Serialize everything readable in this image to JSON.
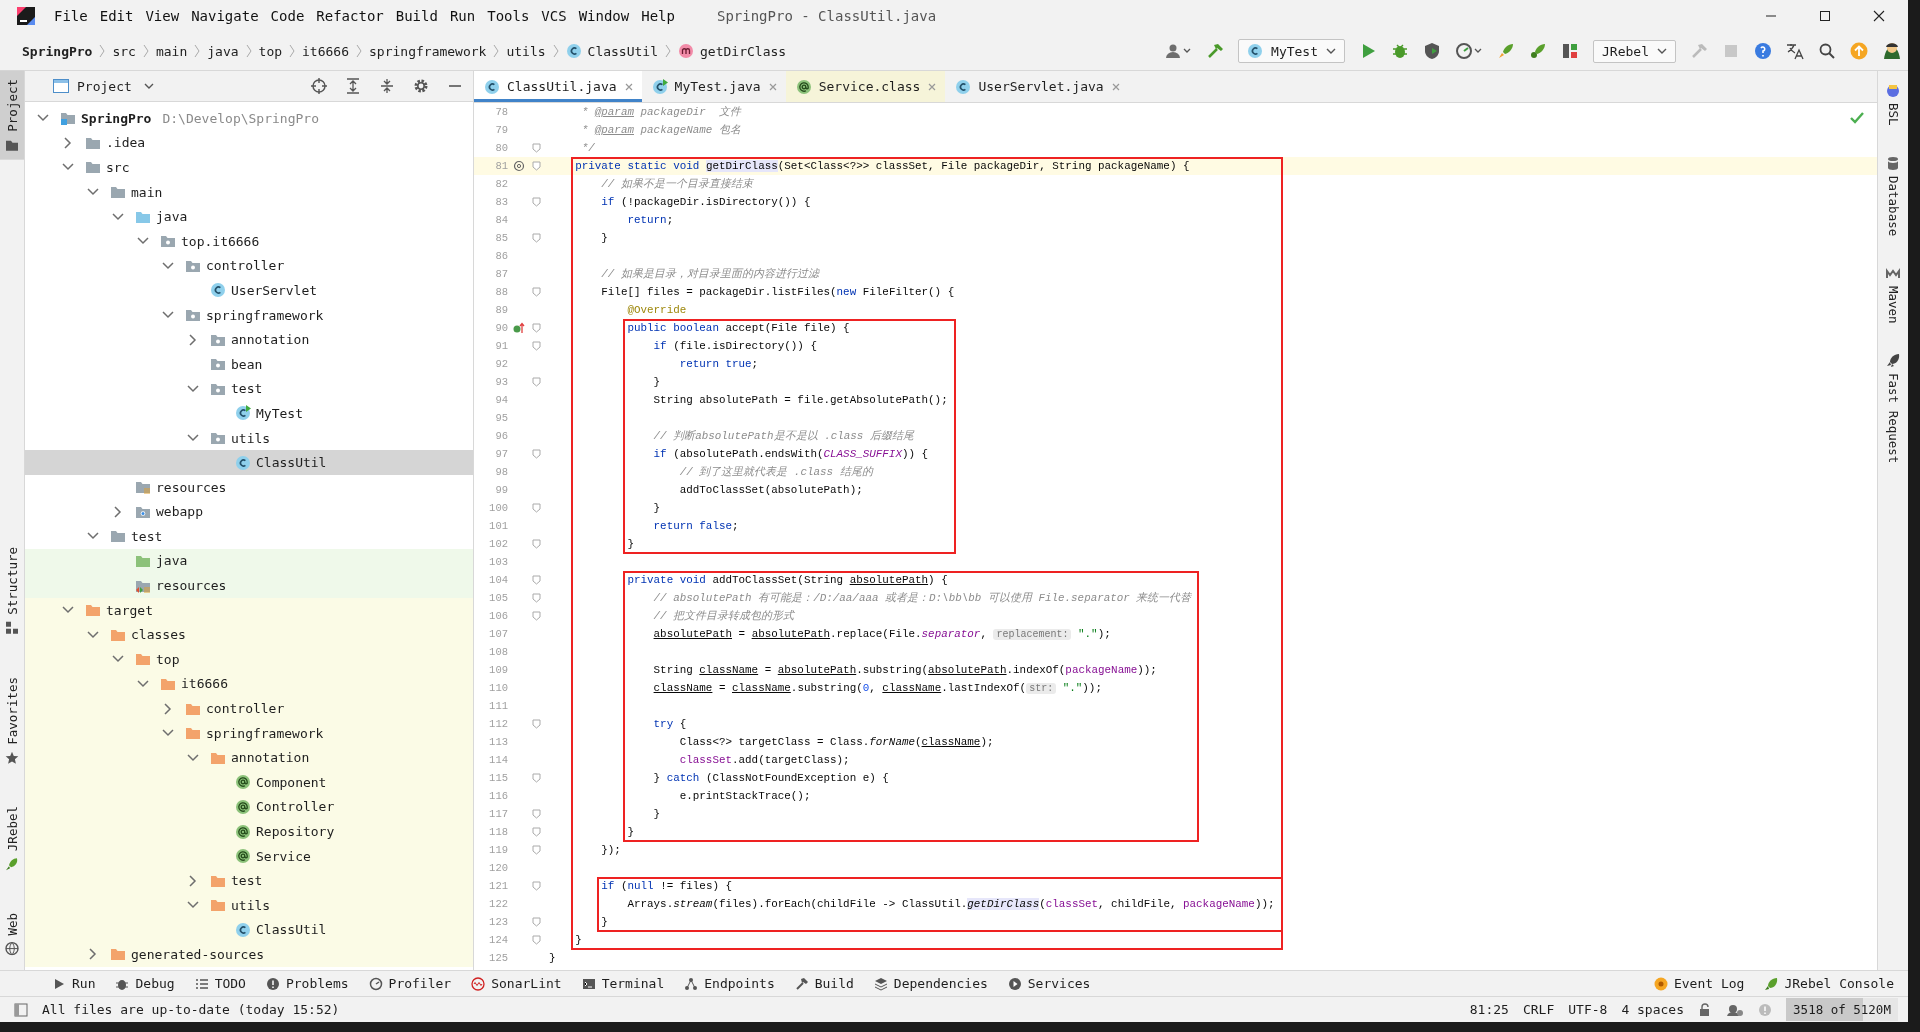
{
  "window": {
    "title": "SpringPro - ClassUtil.java"
  },
  "menu": [
    "File",
    "Edit",
    "View",
    "Navigate",
    "Code",
    "Refactor",
    "Build",
    "Run",
    "Tools",
    "VCS",
    "Window",
    "Help"
  ],
  "breadcrumbs": [
    {
      "label": "SpringPro",
      "kind": "project"
    },
    {
      "label": "src",
      "kind": "folder"
    },
    {
      "label": "main",
      "kind": "folder"
    },
    {
      "label": "java",
      "kind": "folder"
    },
    {
      "label": "top",
      "kind": "folder"
    },
    {
      "label": "it6666",
      "kind": "folder"
    },
    {
      "label": "springframework",
      "kind": "folder"
    },
    {
      "label": "utils",
      "kind": "folder"
    },
    {
      "label": "ClassUtil",
      "kind": "class"
    },
    {
      "label": "getDirClass",
      "kind": "method"
    }
  ],
  "toolbar": {
    "run_configuration": "MyTest",
    "jrebel_menu": "JRebel"
  },
  "left_strip": [
    {
      "label": "Project",
      "selected": true
    },
    {
      "label": "Structure",
      "selected": false
    },
    {
      "label": "Favorites",
      "selected": false
    },
    {
      "label": "JRebel",
      "selected": false
    },
    {
      "label": "Web",
      "selected": false
    }
  ],
  "right_strip": [
    {
      "label": "BSL",
      "selected": false
    },
    {
      "label": "Database",
      "selected": false
    },
    {
      "label": "Maven",
      "selected": false
    },
    {
      "label": "Fast Request",
      "selected": false
    }
  ],
  "project_panel": {
    "title": "Project",
    "tree": [
      {
        "label": "SpringPro",
        "path": "D:\\Develop\\SpringPro",
        "kind": "module",
        "expanded": true,
        "selected": false,
        "children": [
          {
            "label": ".idea",
            "kind": "folder",
            "expanded": false,
            "selected": false
          },
          {
            "label": "src",
            "kind": "folder",
            "expanded": true,
            "selected": false,
            "children": [
              {
                "label": "main",
                "kind": "folder",
                "expanded": true,
                "selected": false,
                "children": [
                  {
                    "label": "java",
                    "kind": "source-root",
                    "expanded": true,
                    "selected": false,
                    "children": [
                      {
                        "label": "top.it6666",
                        "kind": "package",
                        "expanded": true,
                        "selected": false,
                        "children": [
                          {
                            "label": "controller",
                            "kind": "package",
                            "expanded": true,
                            "selected": false,
                            "children": [
                              {
                                "label": "UserServlet",
                                "kind": "class",
                                "selected": false
                              }
                            ]
                          },
                          {
                            "label": "springframework",
                            "kind": "package",
                            "expanded": true,
                            "selected": false,
                            "children": [
                              {
                                "label": "annotation",
                                "kind": "package",
                                "expanded": false,
                                "selected": false
                              },
                              {
                                "label": "bean",
                                "kind": "package",
                                "selected": false
                              },
                              {
                                "label": "test",
                                "kind": "package",
                                "expanded": true,
                                "selected": false,
                                "children": [
                                  {
                                    "label": "MyTest",
                                    "kind": "test-class",
                                    "selected": false
                                  }
                                ]
                              },
                              {
                                "label": "utils",
                                "kind": "package",
                                "expanded": true,
                                "selected": false,
                                "children": [
                                  {
                                    "label": "ClassUtil",
                                    "kind": "class",
                                    "selected": true
                                  }
                                ]
                              }
                            ]
                          }
                        ]
                      }
                    ]
                  },
                  {
                    "label": "resources",
                    "kind": "resources",
                    "selected": false
                  },
                  {
                    "label": "webapp",
                    "kind": "web",
                    "expanded": false,
                    "selected": false
                  }
                ]
              },
              {
                "label": "test",
                "kind": "folder",
                "expanded": true,
                "selected": false,
                "children": [
                  {
                    "label": "java",
                    "kind": "test-root",
                    "selected": false
                  },
                  {
                    "label": "resources",
                    "kind": "test-resources",
                    "selected": false
                  }
                ]
              }
            ]
          },
          {
            "label": "target",
            "kind": "excluded",
            "expanded": true,
            "selected": false,
            "children": [
              {
                "label": "classes",
                "kind": "excluded",
                "expanded": true,
                "selected": false,
                "children": [
                  {
                    "label": "top",
                    "kind": "excluded",
                    "expanded": true,
                    "selected": false,
                    "children": [
                      {
                        "label": "it6666",
                        "kind": "excluded",
                        "expanded": true,
                        "selected": false,
                        "children": [
                          {
                            "label": "controller",
                            "kind": "excluded",
                            "expanded": false,
                            "selected": false
                          },
                          {
                            "label": "springframework",
                            "kind": "excluded",
                            "expanded": true,
                            "selected": false,
                            "children": [
                              {
                                "label": "annotation",
                                "kind": "excluded",
                                "expanded": true,
                                "selected": false,
                                "children": [
                                  {
                                    "label": "Component",
                                    "kind": "annotation",
                                    "selected": false
                                  },
                                  {
                                    "label": "Controller",
                                    "kind": "annotation",
                                    "selected": false
                                  },
                                  {
                                    "label": "Repository",
                                    "kind": "annotation",
                                    "selected": false
                                  },
                                  {
                                    "label": "Service",
                                    "kind": "annotation",
                                    "selected": false
                                  }
                                ]
                              },
                              {
                                "label": "test",
                                "kind": "excluded",
                                "expanded": false,
                                "selected": false
                              },
                              {
                                "label": "utils",
                                "kind": "excluded",
                                "expanded": true,
                                "selected": false,
                                "children": [
                                  {
                                    "label": "ClassUtil",
                                    "kind": "class",
                                    "selected": false
                                  }
                                ]
                              }
                            ]
                          }
                        ]
                      }
                    ]
                  }
                ]
              },
              {
                "label": "generated-sources",
                "kind": "excluded",
                "expanded": false,
                "selected": false
              }
            ]
          }
        ]
      }
    ]
  },
  "editor": {
    "tabs": [
      {
        "label": "ClassUtil.java",
        "kind": "class",
        "selected": true,
        "excluded": false
      },
      {
        "label": "MyTest.java",
        "kind": "test-class",
        "selected": false,
        "excluded": false
      },
      {
        "label": "Service.class",
        "kind": "annotation",
        "selected": false,
        "excluded": true
      },
      {
        "label": "UserServlet.java",
        "kind": "class",
        "selected": false,
        "excluded": false
      }
    ],
    "lines": [
      {
        "number": "78",
        "fold": false,
        "current": false,
        "tokens": [
          {
            "kind": "comment",
            "text": "     * "
          },
          {
            "kind": "doctag",
            "text": "@param"
          },
          {
            "kind": "comment",
            "text": " packageDir  文件"
          }
        ]
      },
      {
        "number": "79",
        "fold": false,
        "current": false,
        "tokens": [
          {
            "kind": "comment",
            "text": "     * "
          },
          {
            "kind": "doctag",
            "text": "@param"
          },
          {
            "kind": "comment",
            "text": " packageName 包名"
          }
        ]
      },
      {
        "number": "80",
        "fold": true,
        "current": false,
        "tokens": [
          {
            "kind": "comment",
            "text": "     */"
          }
        ]
      },
      {
        "number": "81",
        "fold": true,
        "current": true,
        "kind": "usages",
        "frame_start": true,
        "tokens": [
          {
            "kind": "keyword",
            "text": "    private static void "
          },
          {
            "kind": "highlight",
            "text": "getDirClass"
          },
          {
            "kind": "plain",
            "text": "(Set<Class<?>> classSet, File packageDir, String packageName) {"
          }
        ]
      },
      {
        "number": "82",
        "fold": false,
        "current": false,
        "tokens": [
          {
            "kind": "comment",
            "text": "        // 如果不是一个目录直接结束"
          }
        ]
      },
      {
        "number": "83",
        "fold": true,
        "current": false,
        "tokens": [
          {
            "kind": "keyword",
            "text": "        if "
          },
          {
            "kind": "plain",
            "text": "(!packageDir.isDirectory()) {"
          }
        ]
      },
      {
        "number": "84",
        "fold": false,
        "current": false,
        "tokens": [
          {
            "kind": "keyword",
            "text": "            return"
          },
          {
            "kind": "plain",
            "text": ";"
          }
        ]
      },
      {
        "number": "85",
        "fold": true,
        "current": false,
        "tokens": [
          {
            "kind": "plain",
            "text": "        }"
          }
        ]
      },
      {
        "number": "86",
        "fold": false,
        "current": false
      },
      {
        "number": "87",
        "fold": false,
        "current": false,
        "tokens": [
          {
            "kind": "comment",
            "text": "        // 如果是目录，对目录里面的内容进行过滤"
          }
        ]
      },
      {
        "number": "88",
        "fold": true,
        "current": false,
        "tokens": [
          {
            "kind": "plain",
            "text": "        File[] files = packageDir.listFiles("
          },
          {
            "kind": "keyword",
            "text": "new "
          },
          {
            "kind": "plain",
            "text": "FileFilter() {"
          }
        ]
      },
      {
        "number": "89",
        "fold": false,
        "current": false,
        "tokens": [
          {
            "kind": "annotation",
            "text": "            @Override"
          }
        ]
      },
      {
        "number": "90",
        "fold": true,
        "current": false,
        "kind": "override",
        "frame_start": true,
        "tokens": [
          {
            "kind": "keyword",
            "text": "            public boolean "
          },
          {
            "kind": "plain",
            "text": "accept(File file) {"
          }
        ]
      },
      {
        "number": "91",
        "fold": true,
        "current": false,
        "tokens": [
          {
            "kind": "keyword",
            "text": "                if "
          },
          {
            "kind": "plain",
            "text": "(file.isDirectory()) {"
          }
        ]
      },
      {
        "number": "92",
        "fold": false,
        "current": false,
        "tokens": [
          {
            "kind": "keyword",
            "text": "                    return true"
          },
          {
            "kind": "plain",
            "text": ";"
          }
        ]
      },
      {
        "number": "93",
        "fold": true,
        "current": false,
        "tokens": [
          {
            "kind": "plain",
            "text": "                }"
          }
        ]
      },
      {
        "number": "94",
        "fold": false,
        "current": false,
        "tokens": [
          {
            "kind": "plain",
            "text": "                String absolutePath = file.getAbsolutePath();"
          }
        ]
      },
      {
        "number": "95",
        "fold": false,
        "current": false
      },
      {
        "number": "96",
        "fold": false,
        "current": false,
        "tokens": [
          {
            "kind": "comment",
            "text": "                // 判断absolutePath是不是以 .class 后缀结尾"
          }
        ]
      },
      {
        "number": "97",
        "fold": true,
        "current": false,
        "tokens": [
          {
            "kind": "keyword",
            "text": "                if "
          },
          {
            "kind": "plain",
            "text": "(absolutePath.endsWith("
          },
          {
            "kind": "static",
            "text": "CLASS_SUFFIX"
          },
          {
            "kind": "plain",
            "text": ")) {"
          }
        ]
      },
      {
        "number": "98",
        "fold": false,
        "current": false,
        "tokens": [
          {
            "kind": "comment",
            "text": "                    // 到了这里就代表是 .class 结尾的"
          }
        ]
      },
      {
        "number": "99",
        "fold": false,
        "current": false,
        "tokens": [
          {
            "kind": "plain",
            "text": "                    addToClassSet(absolutePath);"
          }
        ]
      },
      {
        "number": "100",
        "fold": true,
        "current": false,
        "tokens": [
          {
            "kind": "plain",
            "text": "                }"
          }
        ]
      },
      {
        "number": "101",
        "fold": false,
        "current": false,
        "tokens": [
          {
            "kind": "keyword",
            "text": "                return false"
          },
          {
            "kind": "plain",
            "text": ";"
          }
        ]
      },
      {
        "number": "102",
        "fold": true,
        "current": false,
        "frame_end": true,
        "tokens": [
          {
            "kind": "plain",
            "text": "            }"
          }
        ]
      },
      {
        "number": "103",
        "fold": false,
        "current": false
      },
      {
        "number": "104",
        "fold": true,
        "current": false,
        "frame_start": true,
        "tokens": [
          {
            "kind": "keyword",
            "text": "            private void "
          },
          {
            "kind": "plain",
            "text": "addToClassSet(String "
          },
          {
            "kind": "reassigned",
            "text": "absolutePath"
          },
          {
            "kind": "plain",
            "text": ") {"
          }
        ]
      },
      {
        "number": "105",
        "fold": true,
        "current": false,
        "tokens": [
          {
            "kind": "comment",
            "text": "                // absolutePath 有可能是：/D:/aa/aaa 或者是：D:\\bb\\bb 可以使用 File.separator 来统一代替"
          }
        ]
      },
      {
        "number": "106",
        "fold": true,
        "current": false,
        "tokens": [
          {
            "kind": "comment",
            "text": "                // 把文件目录转成包的形式"
          }
        ]
      },
      {
        "number": "107",
        "fold": false,
        "current": false,
        "tokens": [
          {
            "kind": "reassigned",
            "text": "                absolutePath"
          },
          {
            "kind": "plain",
            "text": " = "
          },
          {
            "kind": "reassigned",
            "text": "absolutePath"
          },
          {
            "kind": "plain",
            "text": ".replace(File."
          },
          {
            "kind": "static",
            "text": "separator"
          },
          {
            "kind": "plain",
            "text": ", "
          },
          {
            "kind": "hint",
            "text": "replacement:"
          },
          {
            "kind": "string",
            "text": " \".\""
          },
          {
            "kind": "plain",
            "text": ");"
          }
        ]
      },
      {
        "number": "108",
        "fold": false,
        "current": false
      },
      {
        "number": "109",
        "fold": false,
        "current": false,
        "tokens": [
          {
            "kind": "plain",
            "text": "                String "
          },
          {
            "kind": "reassigned",
            "text": "className"
          },
          {
            "kind": "plain",
            "text": " = "
          },
          {
            "kind": "reassigned",
            "text": "absolutePath"
          },
          {
            "kind": "plain",
            "text": ".substring("
          },
          {
            "kind": "reassigned",
            "text": "absolutePath"
          },
          {
            "kind": "plain",
            "text": ".indexOf("
          },
          {
            "kind": "field",
            "text": "packageName"
          },
          {
            "kind": "plain",
            "text": "));"
          }
        ]
      },
      {
        "number": "110",
        "fold": false,
        "current": false,
        "tokens": [
          {
            "kind": "reassigned",
            "text": "                className"
          },
          {
            "kind": "plain",
            "text": " = "
          },
          {
            "kind": "reassigned",
            "text": "className"
          },
          {
            "kind": "plain",
            "text": ".substring("
          },
          {
            "kind": "number",
            "text": "0"
          },
          {
            "kind": "plain",
            "text": ", "
          },
          {
            "kind": "reassigned",
            "text": "className"
          },
          {
            "kind": "plain",
            "text": ".lastIndexOf("
          },
          {
            "kind": "hint",
            "text": "str:"
          },
          {
            "kind": "string",
            "text": " \".\""
          },
          {
            "kind": "plain",
            "text": "));"
          }
        ]
      },
      {
        "number": "111",
        "fold": false,
        "current": false
      },
      {
        "number": "112",
        "fold": true,
        "current": false,
        "tokens": [
          {
            "kind": "keyword",
            "text": "                try "
          },
          {
            "kind": "plain",
            "text": "{"
          }
        ]
      },
      {
        "number": "113",
        "fold": false,
        "current": false,
        "tokens": [
          {
            "kind": "plain",
            "text": "                    Class<?> targetClass = Class."
          },
          {
            "kind": "italic",
            "text": "forName"
          },
          {
            "kind": "plain",
            "text": "("
          },
          {
            "kind": "reassigned",
            "text": "className"
          },
          {
            "kind": "plain",
            "text": ");"
          }
        ]
      },
      {
        "number": "114",
        "fold": false,
        "current": false,
        "tokens": [
          {
            "kind": "field",
            "text": "                    classSet"
          },
          {
            "kind": "plain",
            "text": ".add(targetClass);"
          }
        ]
      },
      {
        "number": "115",
        "fold": true,
        "current": false,
        "tokens": [
          {
            "kind": "plain",
            "text": "                } "
          },
          {
            "kind": "keyword",
            "text": "catch "
          },
          {
            "kind": "plain",
            "text": "(ClassNotFoundException e) {"
          }
        ]
      },
      {
        "number": "116",
        "fold": false,
        "current": false,
        "tokens": [
          {
            "kind": "plain",
            "text": "                    e.printStackTrace();"
          }
        ]
      },
      {
        "number": "117",
        "fold": true,
        "current": false,
        "tokens": [
          {
            "kind": "plain",
            "text": "                }"
          }
        ]
      },
      {
        "number": "118",
        "fold": true,
        "current": false,
        "frame_end": true,
        "tokens": [
          {
            "kind": "plain",
            "text": "            }"
          }
        ]
      },
      {
        "number": "119",
        "fold": true,
        "current": false,
        "tokens": [
          {
            "kind": "plain",
            "text": "        });"
          }
        ]
      },
      {
        "number": "120",
        "fold": false,
        "current": false
      },
      {
        "number": "121",
        "fold": true,
        "current": false,
        "frame_start": true,
        "tokens": [
          {
            "kind": "keyword",
            "text": "        if "
          },
          {
            "kind": "plain",
            "text": "("
          },
          {
            "kind": "keyword",
            "text": "null"
          },
          {
            "kind": "plain",
            "text": " != files) {"
          }
        ]
      },
      {
        "number": "122",
        "fold": false,
        "current": false,
        "tokens": [
          {
            "kind": "plain",
            "text": "            Arrays."
          },
          {
            "kind": "italic",
            "text": "stream"
          },
          {
            "kind": "plain",
            "text": "(files).forEach(childFile -> ClassUtil."
          },
          {
            "kind": "highlight-italic",
            "text": "getDirClass"
          },
          {
            "kind": "plain",
            "text": "("
          },
          {
            "kind": "field",
            "text": "classSet"
          },
          {
            "kind": "plain",
            "text": ", childFile, "
          },
          {
            "kind": "field",
            "text": "packageName"
          },
          {
            "kind": "plain",
            "text": "));"
          }
        ]
      },
      {
        "number": "123",
        "fold": true,
        "current": false,
        "frame_end": true,
        "tokens": [
          {
            "kind": "plain",
            "text": "        }"
          }
        ]
      },
      {
        "number": "124",
        "fold": true,
        "current": false,
        "frame_end": true,
        "tokens": [
          {
            "kind": "plain",
            "text": "    }"
          }
        ]
      },
      {
        "number": "125",
        "fold": false,
        "current": false,
        "tokens": [
          {
            "kind": "plain",
            "text": "}"
          }
        ]
      }
    ]
  },
  "tool_windows": [
    "Run",
    "Debug",
    "TODO",
    "Problems",
    "Profiler",
    "SonarLint",
    "Terminal",
    "Endpoints",
    "Build",
    "Dependencies",
    "Services"
  ],
  "tool_windows_right": [
    "Event Log",
    "JRebel Console"
  ],
  "status_bar": {
    "message": "All files are up-to-date (today 15:52)",
    "items": [
      "81:25",
      "CRLF",
      "UTF-8",
      "4 spaces"
    ],
    "memory": {
      "text": "3518 of 5120M",
      "level": 0.69
    }
  }
}
